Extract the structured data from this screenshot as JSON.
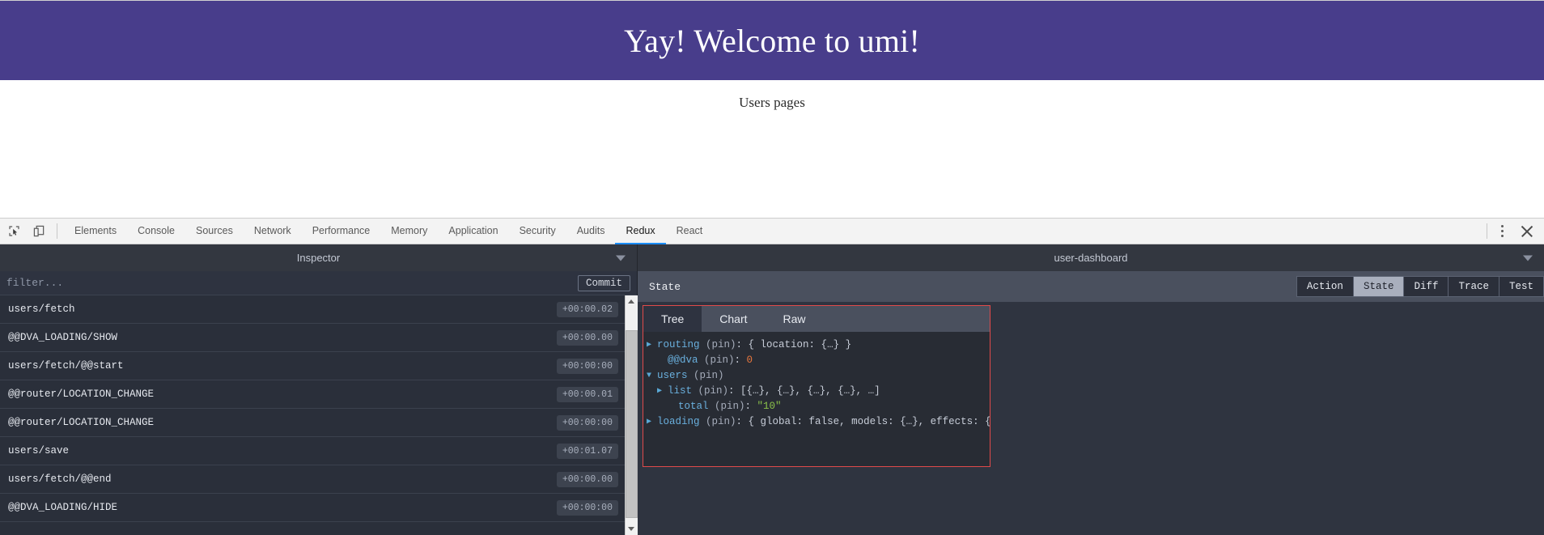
{
  "app": {
    "banner_title": "Yay! Welcome to umi!",
    "subtitle": "Users pages",
    "banner_color": "#483d8b"
  },
  "devtools": {
    "icons": {
      "inspect": "inspect-element-icon",
      "device": "device-toolbar-icon",
      "more": "more-options-icon",
      "close": "close-icon"
    },
    "tabs": [
      {
        "label": "Elements",
        "active": false
      },
      {
        "label": "Console",
        "active": false
      },
      {
        "label": "Sources",
        "active": false
      },
      {
        "label": "Network",
        "active": false
      },
      {
        "label": "Performance",
        "active": false
      },
      {
        "label": "Memory",
        "active": false
      },
      {
        "label": "Application",
        "active": false
      },
      {
        "label": "Security",
        "active": false
      },
      {
        "label": "Audits",
        "active": false
      },
      {
        "label": "Redux",
        "active": true
      },
      {
        "label": "React",
        "active": false
      }
    ],
    "active_tab_underline_color": "#1a8cff"
  },
  "redux": {
    "monitor_selector": "Inspector",
    "instance_selector": "user-dashboard",
    "filter_placeholder": "filter...",
    "filter_value": "",
    "commit_label": "Commit",
    "actions": [
      {
        "name": "users/fetch",
        "time": "+00:00.02"
      },
      {
        "name": "@@DVA_LOADING/SHOW",
        "time": "+00:00.00"
      },
      {
        "name": "users/fetch/@@start",
        "time": "+00:00:00"
      },
      {
        "name": "@@router/LOCATION_CHANGE",
        "time": "+00:00.01"
      },
      {
        "name": "@@router/LOCATION_CHANGE",
        "time": "+00:00:00"
      },
      {
        "name": "users/save",
        "time": "+00:01.07"
      },
      {
        "name": "users/fetch/@@end",
        "time": "+00:00.00"
      },
      {
        "name": "@@DVA_LOADING/HIDE",
        "time": "+00:00:00"
      }
    ],
    "state_panel": {
      "title": "State",
      "modes": [
        {
          "label": "Action",
          "active": false
        },
        {
          "label": "State",
          "active": true
        },
        {
          "label": "Diff",
          "active": false
        },
        {
          "label": "Trace",
          "active": false
        },
        {
          "label": "Test",
          "active": false
        }
      ],
      "view_tabs": [
        {
          "label": "Tree",
          "active": true
        },
        {
          "label": "Chart",
          "active": false
        },
        {
          "label": "Raw",
          "active": false
        }
      ],
      "selection_outline_color": "#e04a4a",
      "tree": [
        {
          "arrow": "▶",
          "indent": 0,
          "key": "routing",
          "pin": " (pin)",
          "sep": ": ",
          "preview": "{ location: {…} }",
          "preview_type": "plain"
        },
        {
          "arrow": "",
          "indent": 1,
          "key": "@@dva",
          "pin": " (pin)",
          "sep": ": ",
          "preview": "0",
          "preview_type": "number"
        },
        {
          "arrow": "▼",
          "indent": 0,
          "key": "users",
          "pin": " (pin)",
          "sep": "",
          "preview": "",
          "preview_type": "plain"
        },
        {
          "arrow": "▶",
          "indent": 1,
          "key": "list",
          "pin": " (pin)",
          "sep": ": ",
          "preview": "[{…}, {…}, {…}, {…}, …]",
          "preview_type": "plain"
        },
        {
          "arrow": "",
          "indent": 2,
          "key": "total",
          "pin": " (pin)",
          "sep": ": ",
          "preview": "\"10\"",
          "preview_type": "string"
        },
        {
          "arrow": "▶",
          "indent": 0,
          "key": "loading",
          "pin": " (pin)",
          "sep": ": ",
          "preview": "{ global: false, models: {…}, effects: {…} }",
          "preview_type": "plain"
        }
      ]
    }
  }
}
